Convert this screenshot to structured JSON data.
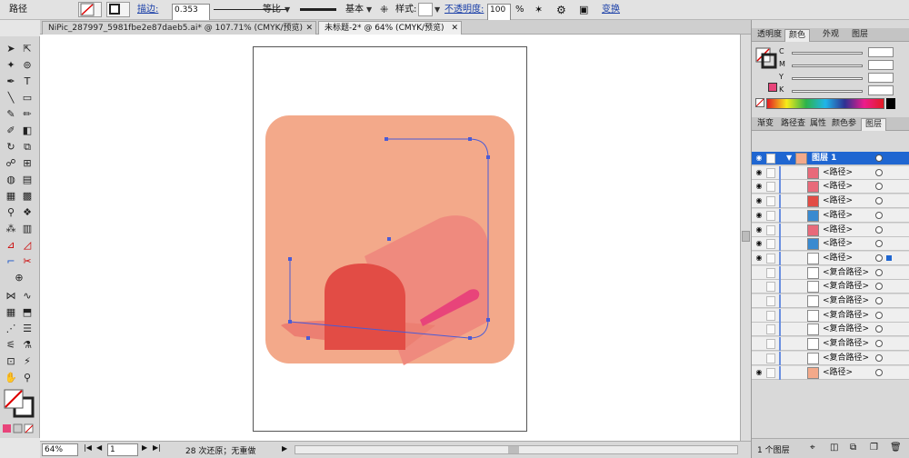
{
  "control_bar": {
    "selection_label": "路径",
    "stroke_link": "描边:",
    "stroke_weight": "0.353",
    "stroke_profile_label": "等比",
    "brush_label": "基本",
    "style_label": "样式:",
    "opacity_link": "不透明度:",
    "opacity_value": "100",
    "opacity_unit": "%",
    "transform_link": "变换"
  },
  "document_tabs": [
    {
      "label": "NiPic_287997_5981fbe2e87daeb5.ai* @ 107.71% (CMYK/预览)",
      "active": false
    },
    {
      "label": "未标题-2* @ 64% (CMYK/预览)",
      "active": true
    }
  ],
  "color_panel": {
    "tabs": [
      "透明度",
      "颜色",
      "外观",
      "图层"
    ],
    "active_tab": "颜色",
    "channels": [
      "C",
      "M",
      "Y",
      "K"
    ],
    "fill_color": "#e8447a"
  },
  "layers_panel": {
    "tabs": [
      "渐变",
      "路径查",
      "属性",
      "颜色参",
      "图层"
    ],
    "active_tab": "图层",
    "top_layer": {
      "name": "图层 1",
      "color": "#1f66d1"
    },
    "rows": [
      {
        "name": "<路径>",
        "visible": true,
        "thumb": "#e86a7a"
      },
      {
        "name": "<路径>",
        "visible": true,
        "thumb": "#e86a7a"
      },
      {
        "name": "<路径>",
        "visible": true,
        "thumb": "#e24c45"
      },
      {
        "name": "<路径>",
        "visible": true,
        "thumb": "#3a8ad0"
      },
      {
        "name": "<路径>",
        "visible": true,
        "thumb": "#e86a7a"
      },
      {
        "name": "<路径>",
        "visible": true,
        "thumb": "#3a8ad0"
      },
      {
        "name": "<路径>",
        "visible": true,
        "thumb": "#ffffff",
        "selected": true
      },
      {
        "name": "<复合路径>",
        "visible": false,
        "thumb": "#ffffff"
      },
      {
        "name": "<复合路径>",
        "visible": false,
        "thumb": "#ffffff"
      },
      {
        "name": "<复合路径>",
        "visible": false,
        "thumb": "#ffffff"
      },
      {
        "name": "<复合路径>",
        "visible": false,
        "thumb": "#ffffff"
      },
      {
        "name": "<复合路径>",
        "visible": false,
        "thumb": "#ffffff"
      },
      {
        "name": "<复合路径>",
        "visible": false,
        "thumb": "#ffffff"
      },
      {
        "name": "<复合路径>",
        "visible": false,
        "thumb": "#ffffff"
      },
      {
        "name": "<路径>",
        "visible": true,
        "thumb": "#f3a98a"
      }
    ],
    "footer_count": "1 个图层"
  },
  "status_bar": {
    "zoom": "64%",
    "page": "1",
    "undo_status": "28 次还原；无重做"
  },
  "artwork_colors": {
    "background": "#f3a98a",
    "mailbox_body": "#ef8a7e",
    "mailbox_front": "#e24c45",
    "flag": "#e8447a",
    "selection": "#4a5bd6"
  }
}
